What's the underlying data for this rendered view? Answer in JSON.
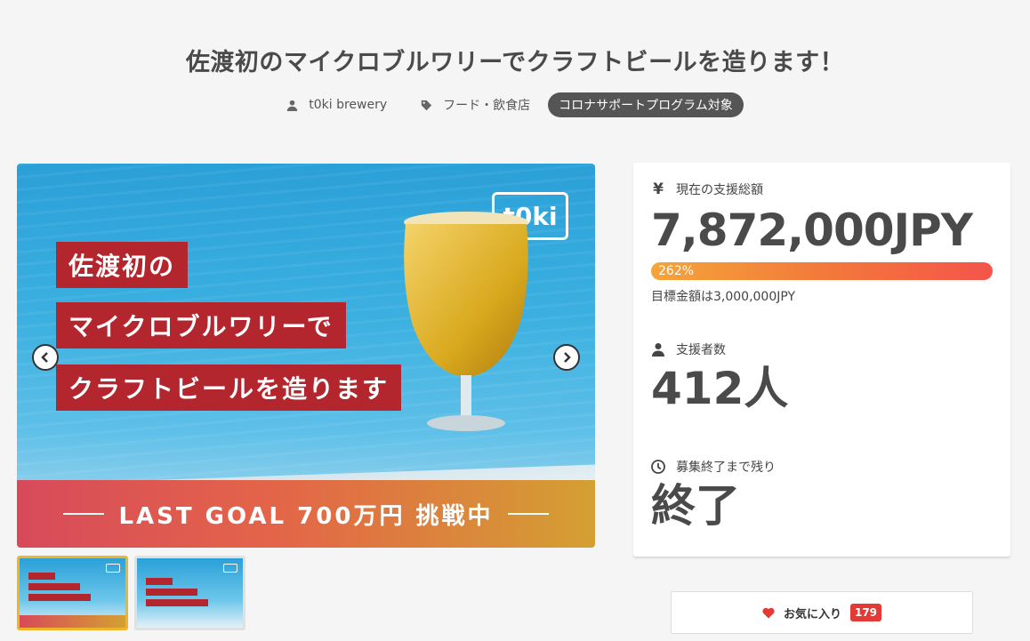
{
  "project": {
    "title": "佐渡初のマイクロブルワリーでクラフトビールを造ります！",
    "owner": "t0ki brewery",
    "category": "フード・飲食店",
    "badge": "コロナサポートプログラム対象"
  },
  "slider": {
    "logo_text": "t0ki",
    "banner_lines": [
      "佐渡初の",
      "マイクロブルワリーで",
      "クラフトビールを造ります"
    ],
    "goal_text": "LAST GOAL 700万円 挑戦中",
    "thumbnail_count": 2,
    "active_thumbnail": 1
  },
  "stats": {
    "amount_label": "現在の支援総額",
    "amount": "7,872,000JPY",
    "progress_percent": 262,
    "progress_label": "262%",
    "goal_text": "目標金額は3,000,000JPY",
    "supporters_label": "支援者数",
    "supporters": "412人",
    "remaining_label": "募集終了まで残り",
    "remaining": "終了"
  },
  "favorite": {
    "label": "お気に入り",
    "count": "179"
  },
  "icons": {
    "yen": "yen-icon",
    "user": "user-icon",
    "tag": "tag-icon",
    "clock": "clock-icon",
    "heart": "heart-icon"
  },
  "colors": {
    "badge_bg": "#555555",
    "progress_start": "#f4a53a",
    "progress_end": "#f4544a",
    "heart": "#e53935",
    "active_thumb": "#f0b429"
  }
}
